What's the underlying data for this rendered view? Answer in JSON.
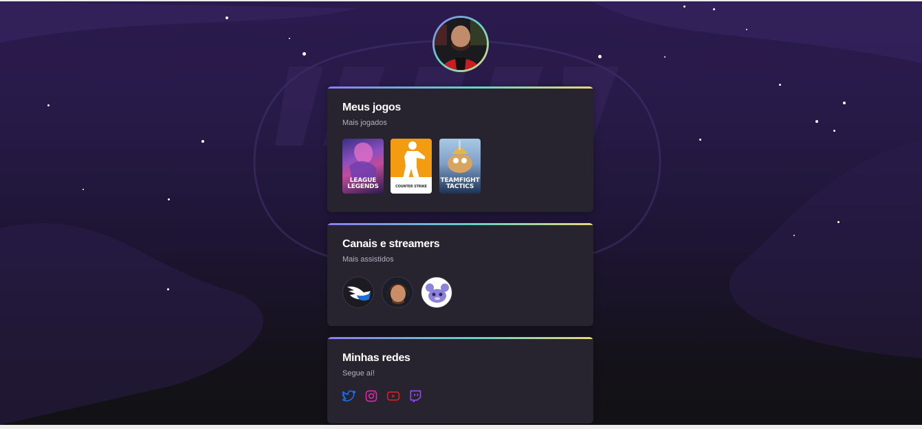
{
  "profile": {
    "avatar_alt": "profile-photo"
  },
  "games_card": {
    "title": "Meus jogos",
    "subtitle": "Mais jogados",
    "games": [
      {
        "name": "League of Legends",
        "label_line1": "LEAGUE",
        "label_line2": "LEGENDS"
      },
      {
        "name": "Counter-Strike",
        "label_line1": "COUNTER STRIKE"
      },
      {
        "name": "Teamfight Tactics",
        "label_line1": "TEAMFIGHT",
        "label_line2": "TACTICS"
      }
    ]
  },
  "streamers_card": {
    "title": "Canais e streamers",
    "subtitle": "Mais assistidos",
    "channels": [
      {
        "name": "channel-1-wings-logo"
      },
      {
        "name": "channel-2-streamer-photo"
      },
      {
        "name": "channel-3-purple-mascot"
      }
    ]
  },
  "socials_card": {
    "title": "Minhas redes",
    "subtitle": "Segue aí!",
    "networks": [
      {
        "name": "twitter-icon",
        "color": "#1d72f3"
      },
      {
        "name": "instagram-icon",
        "color": "#d62aa8"
      },
      {
        "name": "youtube-icon",
        "color": "#e01b24"
      },
      {
        "name": "twitch-icon",
        "color": "#9146ff"
      }
    ]
  }
}
